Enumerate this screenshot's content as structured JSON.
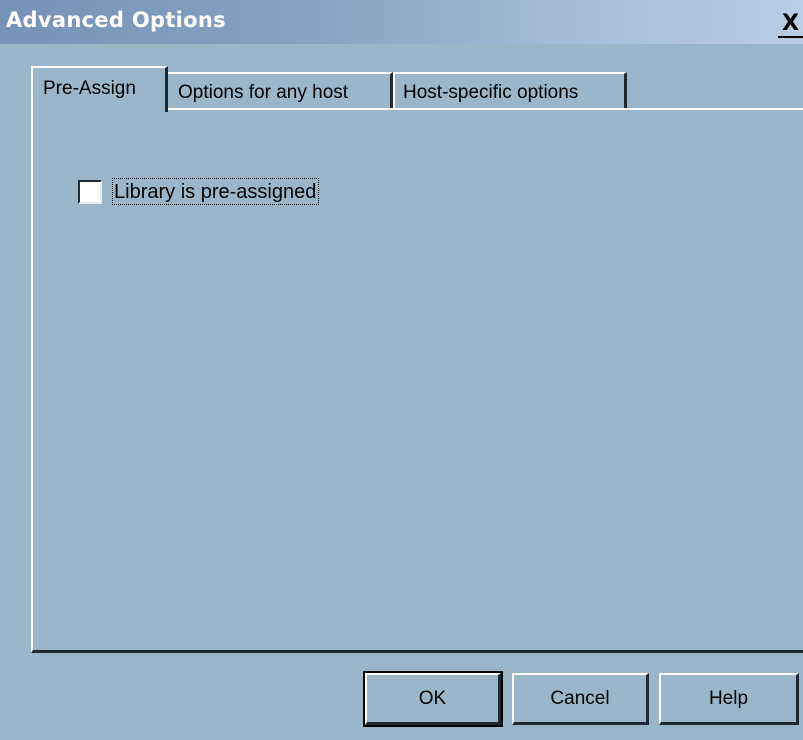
{
  "window": {
    "title": "Advanced Options",
    "close_glyph": "X",
    "close_icon": "close-icon"
  },
  "tabs": [
    {
      "label": "Pre-Assign",
      "active": true
    },
    {
      "label": "Options for any host",
      "active": false
    },
    {
      "label": "Host-specific options",
      "active": false
    }
  ],
  "pre_assign": {
    "checkbox_label": "Library is pre-assigned",
    "checked": false
  },
  "buttons": {
    "ok": "OK",
    "cancel": "Cancel",
    "help": "Help"
  },
  "colors": {
    "dialog_bg": "#9cb6c9",
    "titlebar_start": "#7792b7",
    "titlebar_end": "#b9cde2"
  }
}
